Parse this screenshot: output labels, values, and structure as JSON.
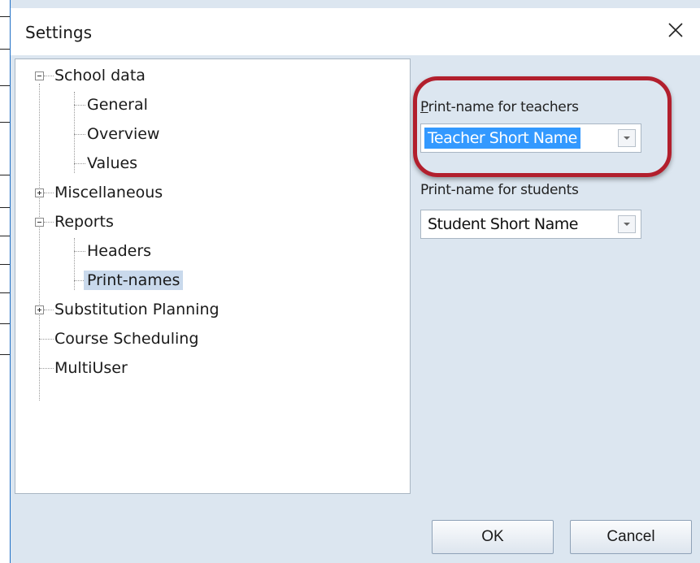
{
  "window": {
    "title": "Settings"
  },
  "tree": {
    "nodes": [
      {
        "label": "School data",
        "expander": "minus"
      },
      {
        "label": "General"
      },
      {
        "label": "Overview"
      },
      {
        "label": "Values"
      },
      {
        "label": "Miscellaneous",
        "expander": "plus"
      },
      {
        "label": "Reports",
        "expander": "minus"
      },
      {
        "label": "Headers"
      },
      {
        "label": "Print-names",
        "selected": true
      },
      {
        "label": "Substitution Planning",
        "expander": "plus"
      },
      {
        "label": "Course Scheduling"
      },
      {
        "label": "MultiUser"
      }
    ]
  },
  "settings": {
    "teachers": {
      "label_first": "P",
      "label_rest": "rint-name for teachers",
      "value": "Teacher Short Name"
    },
    "students": {
      "label": "Print-name for students",
      "value": "Student Short Name"
    }
  },
  "buttons": {
    "ok": "OK",
    "cancel": "Cancel"
  },
  "colors": {
    "accent_ring": "#b21f2d",
    "selection": "#3399ff",
    "dialog_bg": "#dce6f0"
  }
}
